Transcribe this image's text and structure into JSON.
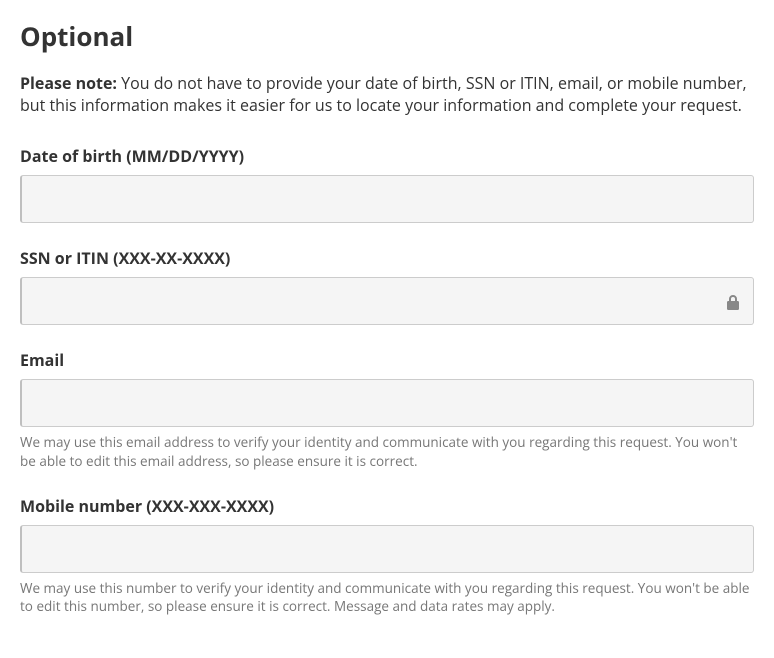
{
  "section": {
    "title": "Optional"
  },
  "note": {
    "prefix": "Please note:",
    "body": "You do not have to provide your date of birth, SSN or ITIN, email, or mobile number, but this information makes it easier for us to locate your information and complete your request."
  },
  "fields": {
    "dob": {
      "label": "Date of birth (MM/DD/YYYY)",
      "value": ""
    },
    "ssn": {
      "label": "SSN or ITIN (XXX-XX-XXXX)",
      "value": ""
    },
    "email": {
      "label": "Email",
      "value": "",
      "helper": "We may use this email address to verify your identity and communicate with you regarding this request. You won't be able to edit this email address, so please ensure it is correct."
    },
    "mobile": {
      "label": "Mobile number (XXX-XXX-XXXX)",
      "value": "",
      "helper": "We may use this number to verify your identity and communicate with you regarding this request. You won't be able to edit this number, so please ensure it is correct. Message and data rates may apply."
    }
  }
}
